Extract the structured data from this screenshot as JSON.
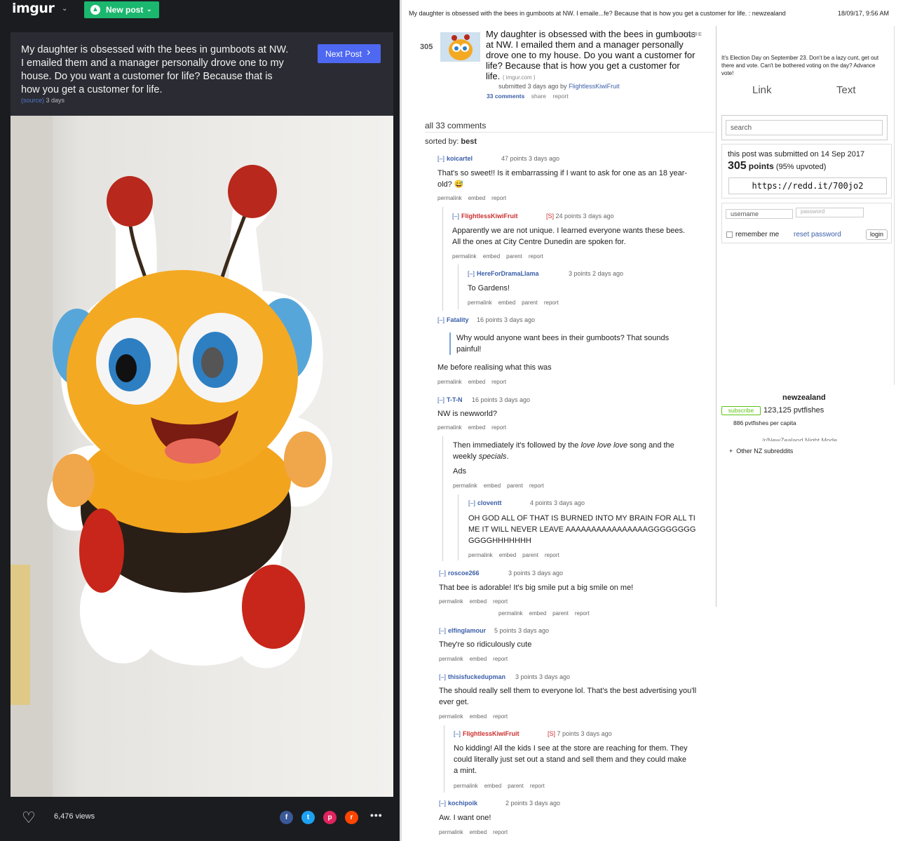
{
  "imgur": {
    "logo": "imgur",
    "new_post": "New post",
    "title": "My daughter is obsessed with the bees in gumboots at NW. I emailed them and a manager personally drove one to my house. Do you want a customer for life? Because that is how you get a customer for life.",
    "source_label": "(source)",
    "age": "3 days",
    "next_post": "Next Post",
    "views": "6,476 views",
    "share": {
      "facebook": "f",
      "twitter": "t",
      "pinterest": "p",
      "reddit": "r"
    }
  },
  "reddit": {
    "page_title": "My daughter is obsessed with the bees in gumboots at NW. I emaile...fe? Because that is how you get a customer for life. : newzealand",
    "print_time": "18/09/17, 9:56 AM",
    "post": {
      "score": "305",
      "title": "My daughter is obsessed with the bees in gumboots at NW. I emailed them and a manager personally drove one to my house. Do you want a customer for life? Because that is how you get a customer for life.",
      "domain": "( imgur.com )",
      "tag": "PICTURE",
      "submitted": "submitted 3 days ago by",
      "author": "FlightlessKiwiFruit",
      "comments_link": "33 comments",
      "share": "share",
      "report": "report"
    },
    "all_comments": "all 33 comments",
    "sorted_label": "sorted by:",
    "sorted_value": "best",
    "links": {
      "permalink": "permalink",
      "embed": "embed",
      "parent": "parent",
      "report": "report"
    },
    "comments": [
      {
        "author": "koicartel",
        "points": "47 points 3 days ago",
        "text": "That's so sweet!! Is it embarrassing if I want to ask for one as an 18 year-old? 😅"
      },
      {
        "author": "FlightlessKiwiFruit",
        "sub": "[S]",
        "points": "24 points 3 days ago",
        "text": "Apparently we are not unique. I learned everyone wants these bees. All the ones at City Centre Dunedin are spoken for."
      },
      {
        "author": "HereForDramaLlama",
        "points": "3 points 2 days ago",
        "text": "To Gardens!"
      },
      {
        "author": "Fatality",
        "points": "16 points 3 days ago",
        "quote": "Why would anyone want bees in their gumboots? That sounds painful!",
        "text": "Me before realising what this was"
      },
      {
        "author": "T-T-N",
        "points": "16 points 3 days ago",
        "text": "NW is newworld?"
      },
      {
        "text_a": "Then immediately it's followed by the ",
        "text_em1": "love love love",
        "text_b": " song and the weekly ",
        "text_em2": "specials",
        "text_c": ".",
        "text2": "Ads"
      },
      {
        "author": "cloventt",
        "points": "4 points 3 days ago",
        "text": "OH GOD ALL OF THAT IS BURNED INTO MY BRAIN FOR ALL TIME IT WILL NEVER LEAVE AAAAAAAAAAAAAAAAGGGGGGGGGGGGHHHHHHH"
      },
      {
        "author": "roscoe266",
        "points": "3 points 3 days ago",
        "text": "That bee is adorable! It's big smile put a big smile on me!"
      },
      {
        "author": "elfinglamour",
        "points": "5 points 3 days ago",
        "text": "They're so ridiculously cute"
      },
      {
        "author": "thisisfuckedupman",
        "points": "3 points 3 days ago",
        "text": "The should really sell them to everyone lol. That's the best advertising you'll ever get."
      },
      {
        "author": "FlightlessKiwiFruit",
        "sub": "[S]",
        "points": "7 points 3 days ago",
        "text": "No kidding! All the kids I see at the store are reaching for them. They could literally just set out a stand and sell them and they could make a mint."
      },
      {
        "author": "kochipoik",
        "points": "2 points 3 days ago",
        "text": "Aw. I want one!"
      }
    ],
    "sidebar": {
      "election": "It's Election Day on September 23. Don't be a lazy cunt, get out there and vote. Can't be bothered voting on the day? Advance vote!",
      "tab_link": "Link",
      "tab_text": "Text",
      "search_placeholder": "search",
      "submitted_on": "this post was submitted on 14 Sep 2017",
      "points_value": "305",
      "points_label": "points",
      "upvoted": "(95% upvoted)",
      "shortlink": "https://redd.it/700jo2",
      "username_placeholder": "username",
      "password_placeholder": "password",
      "remember_me": "remember me",
      "reset_password": "reset password",
      "login": "login",
      "subreddit": "newzealand",
      "subscribe": "subscribe",
      "subscribers": "123,125 pvtfishes",
      "per_capita": "886 pvtfishes per capita",
      "night_mode": "/r/NewZealand Night Mode",
      "other_nz": "Other NZ subreddits"
    }
  },
  "colors": {
    "imgur_bg": "#1b1c20",
    "imgur_header": "#2b2c33",
    "new_post_green": "#1bb76e",
    "next_post_blue": "#4e68f2",
    "reddit_link": "#3a5ea8",
    "op_red": "#cc2f2f"
  }
}
